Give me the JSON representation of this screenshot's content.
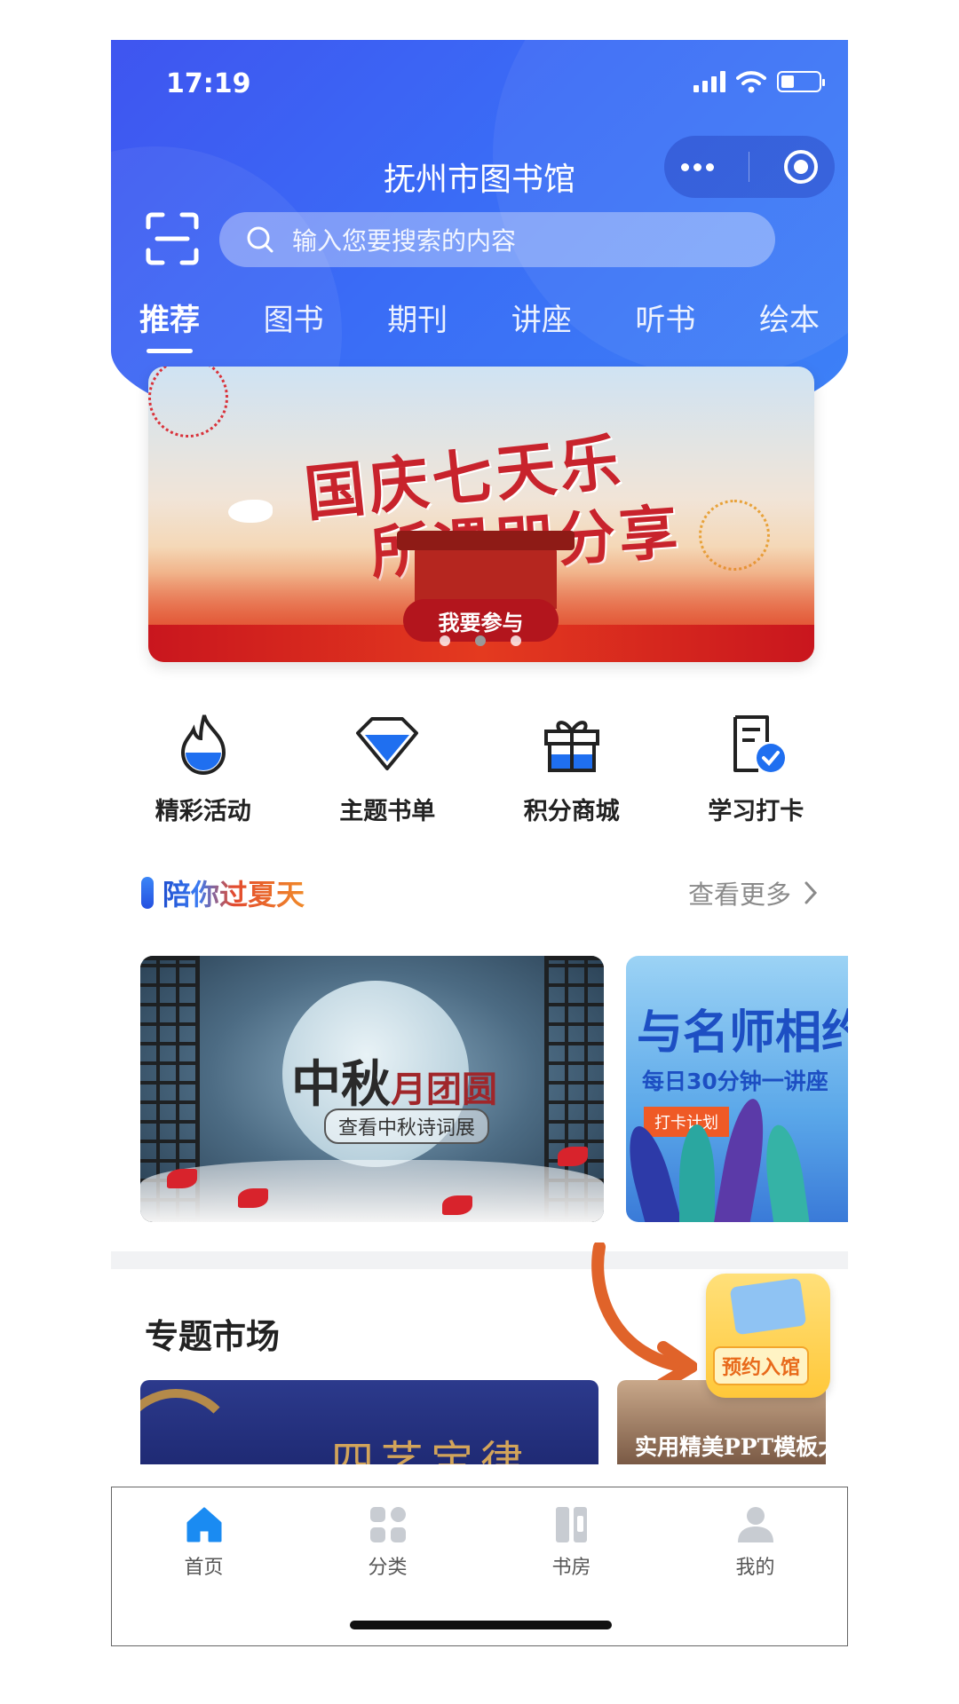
{
  "status_bar": {
    "time": "17:19"
  },
  "header": {
    "title": "抚州市图书馆",
    "search_placeholder": "输入您要搜索的内容"
  },
  "tabs": [
    {
      "label": "推荐",
      "active": true
    },
    {
      "label": "图书",
      "active": false
    },
    {
      "label": "期刊",
      "active": false
    },
    {
      "label": "讲座",
      "active": false
    },
    {
      "label": "听书",
      "active": false
    },
    {
      "label": "绘本",
      "active": false
    }
  ],
  "banner": {
    "line1": "国庆七天乐",
    "line2": "所遇即分享",
    "button": "我要参与"
  },
  "quick_links": [
    {
      "label": "精彩活动",
      "icon": "flame-icon"
    },
    {
      "label": "主题书单",
      "icon": "diamond-icon"
    },
    {
      "label": "积分商城",
      "icon": "gift-icon"
    },
    {
      "label": "学习打卡",
      "icon": "checklist-icon"
    }
  ],
  "summer_section": {
    "title": "陪你过夏天",
    "more": "查看更多"
  },
  "cards": [
    {
      "title_big": "中秋",
      "title_small": "月团圆",
      "subtitle": "查看中秋诗词展"
    },
    {
      "title": "与名师相约",
      "subtitle": "每日30分钟一讲座",
      "tag": "打卡计划"
    }
  ],
  "special_market": {
    "title": "专题市场",
    "items": [
      {
        "text": "四艺宝律"
      },
      {
        "text": "实用精美PPT模板大全"
      }
    ]
  },
  "float_button": {
    "label": "预约入馆"
  },
  "tabbar": [
    {
      "label": "首页",
      "icon": "home-icon",
      "active": true
    },
    {
      "label": "分类",
      "icon": "category-icon",
      "active": false
    },
    {
      "label": "书房",
      "icon": "bookshelf-icon",
      "active": false
    },
    {
      "label": "我的",
      "icon": "profile-icon",
      "active": false
    }
  ],
  "colors": {
    "header_blue": "#3a6cf6",
    "active_tab": "#1a8bf2",
    "banner_red": "#c8232c",
    "float_yellow": "#ffc83a"
  }
}
